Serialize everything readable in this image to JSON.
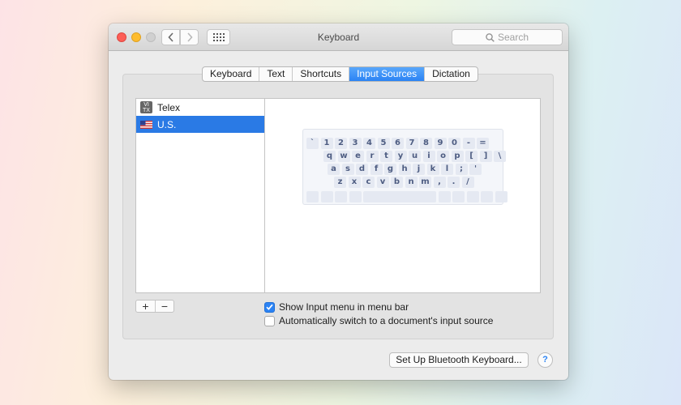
{
  "window": {
    "title": "Keyboard",
    "search_placeholder": "Search"
  },
  "tabs": [
    {
      "label": "Keyboard",
      "active": false
    },
    {
      "label": "Text",
      "active": false
    },
    {
      "label": "Shortcuts",
      "active": false
    },
    {
      "label": "Input Sources",
      "active": true
    },
    {
      "label": "Dictation",
      "active": false
    }
  ],
  "input_sources": [
    {
      "label": "Telex",
      "icon": "vi-icon",
      "icon_text": "VI TX",
      "selected": false
    },
    {
      "label": "U.S.",
      "icon": "us-flag-icon",
      "selected": true
    }
  ],
  "keyboard_preview": {
    "rows": [
      [
        "`",
        "1",
        "2",
        "3",
        "4",
        "5",
        "6",
        "7",
        "8",
        "9",
        "0",
        "-",
        "="
      ],
      [
        "q",
        "w",
        "e",
        "r",
        "t",
        "y",
        "u",
        "i",
        "o",
        "p",
        "[",
        "]",
        "\\"
      ],
      [
        "a",
        "s",
        "d",
        "f",
        "g",
        "h",
        "j",
        "k",
        "l",
        ";",
        "'"
      ],
      [
        "z",
        "x",
        "c",
        "v",
        "b",
        "n",
        "m",
        ",",
        ".",
        "/"
      ]
    ]
  },
  "list_controls": {
    "add_label": "+",
    "remove_label": "−"
  },
  "options": {
    "show_input_menu": {
      "label": "Show Input menu in menu bar",
      "checked": true
    },
    "auto_switch": {
      "label": "Automatically switch to a document's input source",
      "checked": false
    }
  },
  "footer": {
    "setup_bluetooth_label": "Set Up Bluetooth Keyboard...",
    "help_label": "?"
  },
  "colors": {
    "accent": "#2b83f4",
    "selection": "#2a7ae5",
    "close": "#fd5e57",
    "minimize": "#febc2e"
  }
}
